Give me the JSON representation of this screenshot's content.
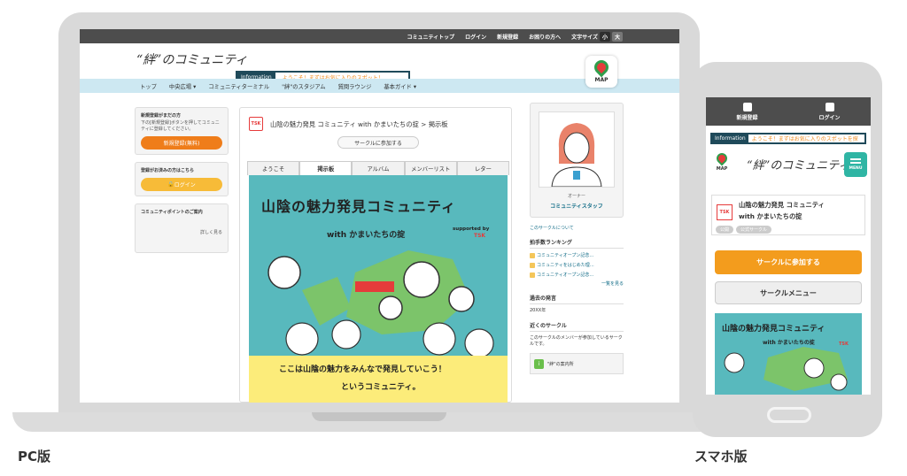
{
  "labels": {
    "pc": "PC版",
    "sp": "スマホ版"
  },
  "colors": {
    "accent_orange": "#ef7d1a",
    "accent_yellow": "#f7bb38",
    "nav_bg": "#cde8f2",
    "topbar_bg": "#4d4d4d",
    "link": "#0f6b86",
    "menu_teal": "#2fb5a4"
  },
  "pc": {
    "topbar": {
      "items": [
        "コミュニティトップ",
        "ログイン",
        "新規登録",
        "お困りの方へ"
      ],
      "font_size_label": "文字サイズ",
      "font_small": "小",
      "font_large": "大"
    },
    "header": {
      "logo": "“絆”のコミュニティ",
      "info_label": "Information",
      "info_text": "ようこそ！まずはお気に入りのスポット！",
      "map_label": "MAP"
    },
    "nav": {
      "items": [
        "トップ",
        "中央広場 ▾",
        "コミュニティターミナル",
        "\"絆\"のスタジアム",
        "質問ラウンジ",
        "基本ガイド ▾"
      ]
    },
    "left": {
      "register_title": "新規登録がまだの方",
      "register_desc": "下の[新規登録]ボタンを押してコミュニティに登録してください。",
      "register_button": "新規登録(無料)",
      "login_title": "登録がお済みの方はこちら",
      "login_button": "ログイン",
      "points_title": "コミュニティポイントのご案内",
      "points_link": "詳しく見る"
    },
    "main": {
      "badge": "TSK",
      "title": "山陰の魅力発見 コミュニティ with かまいたちの掟 > 掲示板",
      "join_button": "サークルに参加する",
      "tabs": [
        "ようこそ",
        "掲示板",
        "アルバム",
        "メンバーリスト",
        "レター"
      ],
      "banner_title": "山陰の魅力発見コミュニティ",
      "banner_with": "with かまいたちの掟",
      "banner_supported": "supported by",
      "banner_tsk": "TSK",
      "banner_slogan1": "ここは山陰の魅力をみんなで発見していこう！",
      "banner_slogan2": "というコミュニティ。"
    },
    "right": {
      "owner_label": "オーナー",
      "owner_name": "コミュニティスタッフ",
      "about_link": "このサークルについて",
      "ranking_heading": "拍手数ランキング",
      "ranking": [
        "コミュニティオープン記念…",
        "コミュニティをはじめた理…",
        "コミュニティオープン記念…"
      ],
      "ranking_more": "一覧を見る",
      "past_heading": "過去の発言",
      "past_item": "20XX年",
      "nearby_heading": "近くのサークル",
      "nearby_text": "このサークルのメンバーが参加しているサークルです。",
      "nearby_item": "\"絆\"の案内所"
    }
  },
  "sp": {
    "top": {
      "register": "新規登録",
      "login": "ログイン"
    },
    "info_label": "Information",
    "info_text": "ようこそ！まずはお気に入りのスポットを探",
    "map_label": "MAP",
    "logo": "“絆”のコミュニティ",
    "menu_label": "MENU",
    "badge": "TSK",
    "title1": "山陰の魅力発見 コミュニティ",
    "title2": "with かまいたちの掟",
    "tags": [
      "公開",
      "公式サークル"
    ],
    "join_button": "サークルに参加する",
    "circle_menu": "サークルメニュー",
    "banner_title": "山陰の魅力発見コミュニティ",
    "banner_with": "with かまいたちの掟",
    "banner_tsk": "TSK"
  }
}
